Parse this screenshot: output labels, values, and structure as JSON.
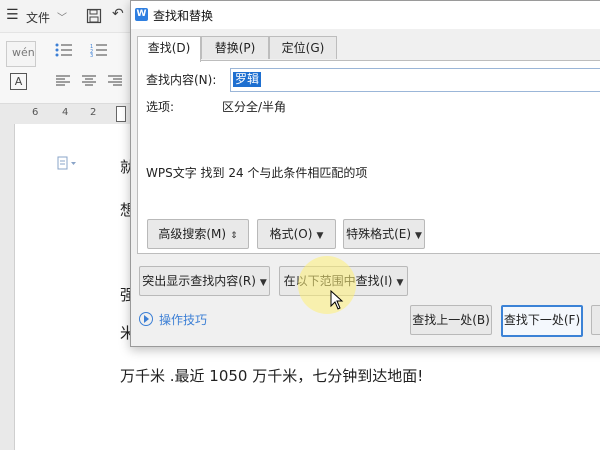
{
  "writer": {
    "menu_icon": "hamburger-icon",
    "file_menu": "文件",
    "ruler_numbers": [
      "6",
      "4",
      "2"
    ],
    "doc_lines": [
      "就",
      "想",
      "强",
      "米",
      "万千米 .最近 1050 万千米，七分钟到达地面!"
    ]
  },
  "dialog": {
    "title": "查找和替换",
    "logo_letter": "W",
    "tabs": [
      {
        "label": "查找(D)",
        "active": true
      },
      {
        "label": "替换(P)",
        "active": false
      },
      {
        "label": "定位(G)",
        "active": false
      }
    ],
    "find_label": "查找内容(N):",
    "find_value": "罗辑",
    "options_label": "选项:",
    "options_value": "区分全/半角",
    "result_text": "WPS文字 找到 24 个与此条件相匹配的项",
    "buttons": {
      "advanced_search": "高级搜索(M)",
      "format": "格式(O)",
      "special_format": "特殊格式(E)",
      "highlight": "突出显示查找内容(R)",
      "find_in": "在以下范围中查找(I)",
      "find_prev": "查找上一处(B)",
      "find_next": "查找下一处(F)"
    },
    "tips_label": "操作技巧"
  }
}
